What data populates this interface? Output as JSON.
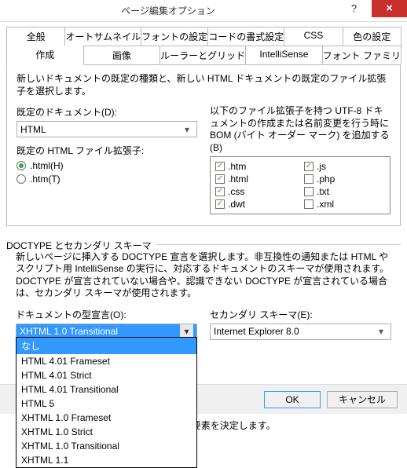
{
  "window": {
    "title": "ページ編集オプション"
  },
  "tabs_row1": [
    "全般",
    "オートサムネイル",
    "フォントの設定",
    "コードの書式設定",
    "CSS",
    "色の設定"
  ],
  "tabs_row2": [
    "作成",
    "画像",
    "ルーラーとグリッド",
    "IntelliSense",
    "フォント ファミリ"
  ],
  "active_tab": "作成",
  "section1": {
    "desc": "新しいドキュメントの既定の種類と、新しい HTML ドキュメントの既定のファイル拡張子を選択します。",
    "default_doc_label": "既定のドキュメント(D):",
    "default_doc_value": "HTML",
    "ext_label": "既定の HTML ファイル拡張子:",
    "ext_radio": [
      ".html(H)",
      ".htm(T)"
    ],
    "ext_radio_selected": 0,
    "utf8_label1": "以下のファイル拡張子を持つ UTF-8 ドキュメントの作成または名前変更を行う時に",
    "utf8_label2": "BOM (バイト オーダー マーク) を追加する(B)",
    "exts": [
      {
        "label": ".htm",
        "checked": true
      },
      {
        "label": ".js",
        "checked": true
      },
      {
        "label": ".html",
        "checked": true
      },
      {
        "label": ".php",
        "checked": false
      },
      {
        "label": ".css",
        "checked": true
      },
      {
        "label": ".txt",
        "checked": false
      },
      {
        "label": ".dwt",
        "checked": true
      },
      {
        "label": ".xml",
        "checked": false
      }
    ]
  },
  "section2": {
    "legend": "DOCTYPE とセカンダリ スキーマ",
    "desc": "新しいページに挿入する DOCTYPE 宣言を選択します。非互換性の通知または HTML やスクリプト用 IntelliSense の実行に、対応するドキュメントのスキーマが使用されます。DOCTYPE が宣言されていない場合や、認識できない DOCTYPE が宣言されている場合は、セカンダリ スキーマが使用されます。",
    "doctype_label": "ドキュメントの型宣言(O):",
    "doctype_value": "XHTML 1.0 Transitional",
    "doctype_options": [
      "なし",
      "HTML 4.01 Frameset",
      "HTML 4.01 Strict",
      "HTML 4.01 Transitional",
      "HTML 5",
      "XHTML 1.0 Frameset",
      "XHTML 1.0 Strict",
      "XHTML 1.0 Transitional",
      "XHTML 1.1"
    ],
    "secondary_label": "セカンダリ スキーマ(E):",
    "secondary_value": "Internet Explorer 8.0",
    "css_note": "きる要素を決定します。"
  },
  "footer": {
    "ok": "OK",
    "cancel": "キャンセル"
  }
}
